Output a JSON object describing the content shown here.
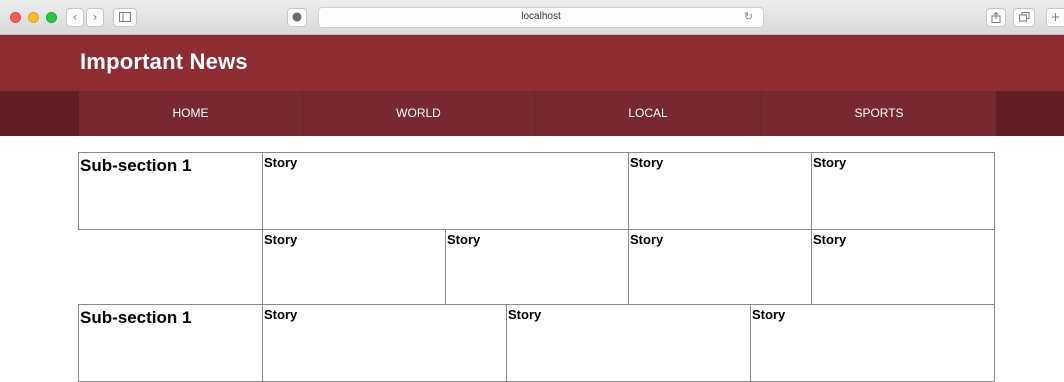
{
  "browser": {
    "url": "localhost",
    "back_icon": "chevron-left",
    "forward_icon": "chevron-right",
    "sidebar_icon": "sidebar",
    "privacy_icon": "shield",
    "reload_icon": "reload",
    "share_icon": "share",
    "tabs_icon": "tabs",
    "new_tab_icon": "plus"
  },
  "site": {
    "title": "Important News"
  },
  "nav": {
    "items": [
      {
        "label": "HOME"
      },
      {
        "label": "WORLD"
      },
      {
        "label": "LOCAL"
      },
      {
        "label": "SPORTS"
      }
    ]
  },
  "sections": [
    {
      "label": "Sub-section 1",
      "rows": [
        {
          "stories": [
            {
              "label": "Story"
            },
            {
              "label": "Story"
            },
            {
              "label": "Story"
            }
          ]
        },
        {
          "stories": [
            {
              "label": "Story"
            },
            {
              "label": "Story"
            },
            {
              "label": "Story"
            },
            {
              "label": "Story"
            }
          ]
        }
      ]
    },
    {
      "label": "Sub-section 1",
      "rows": [
        {
          "stories": [
            {
              "label": "Story"
            },
            {
              "label": "Story"
            },
            {
              "label": "Story"
            }
          ]
        }
      ]
    }
  ],
  "colors": {
    "header": "#8e2c34",
    "nav": "#772830",
    "nav_edge": "#631f26"
  }
}
